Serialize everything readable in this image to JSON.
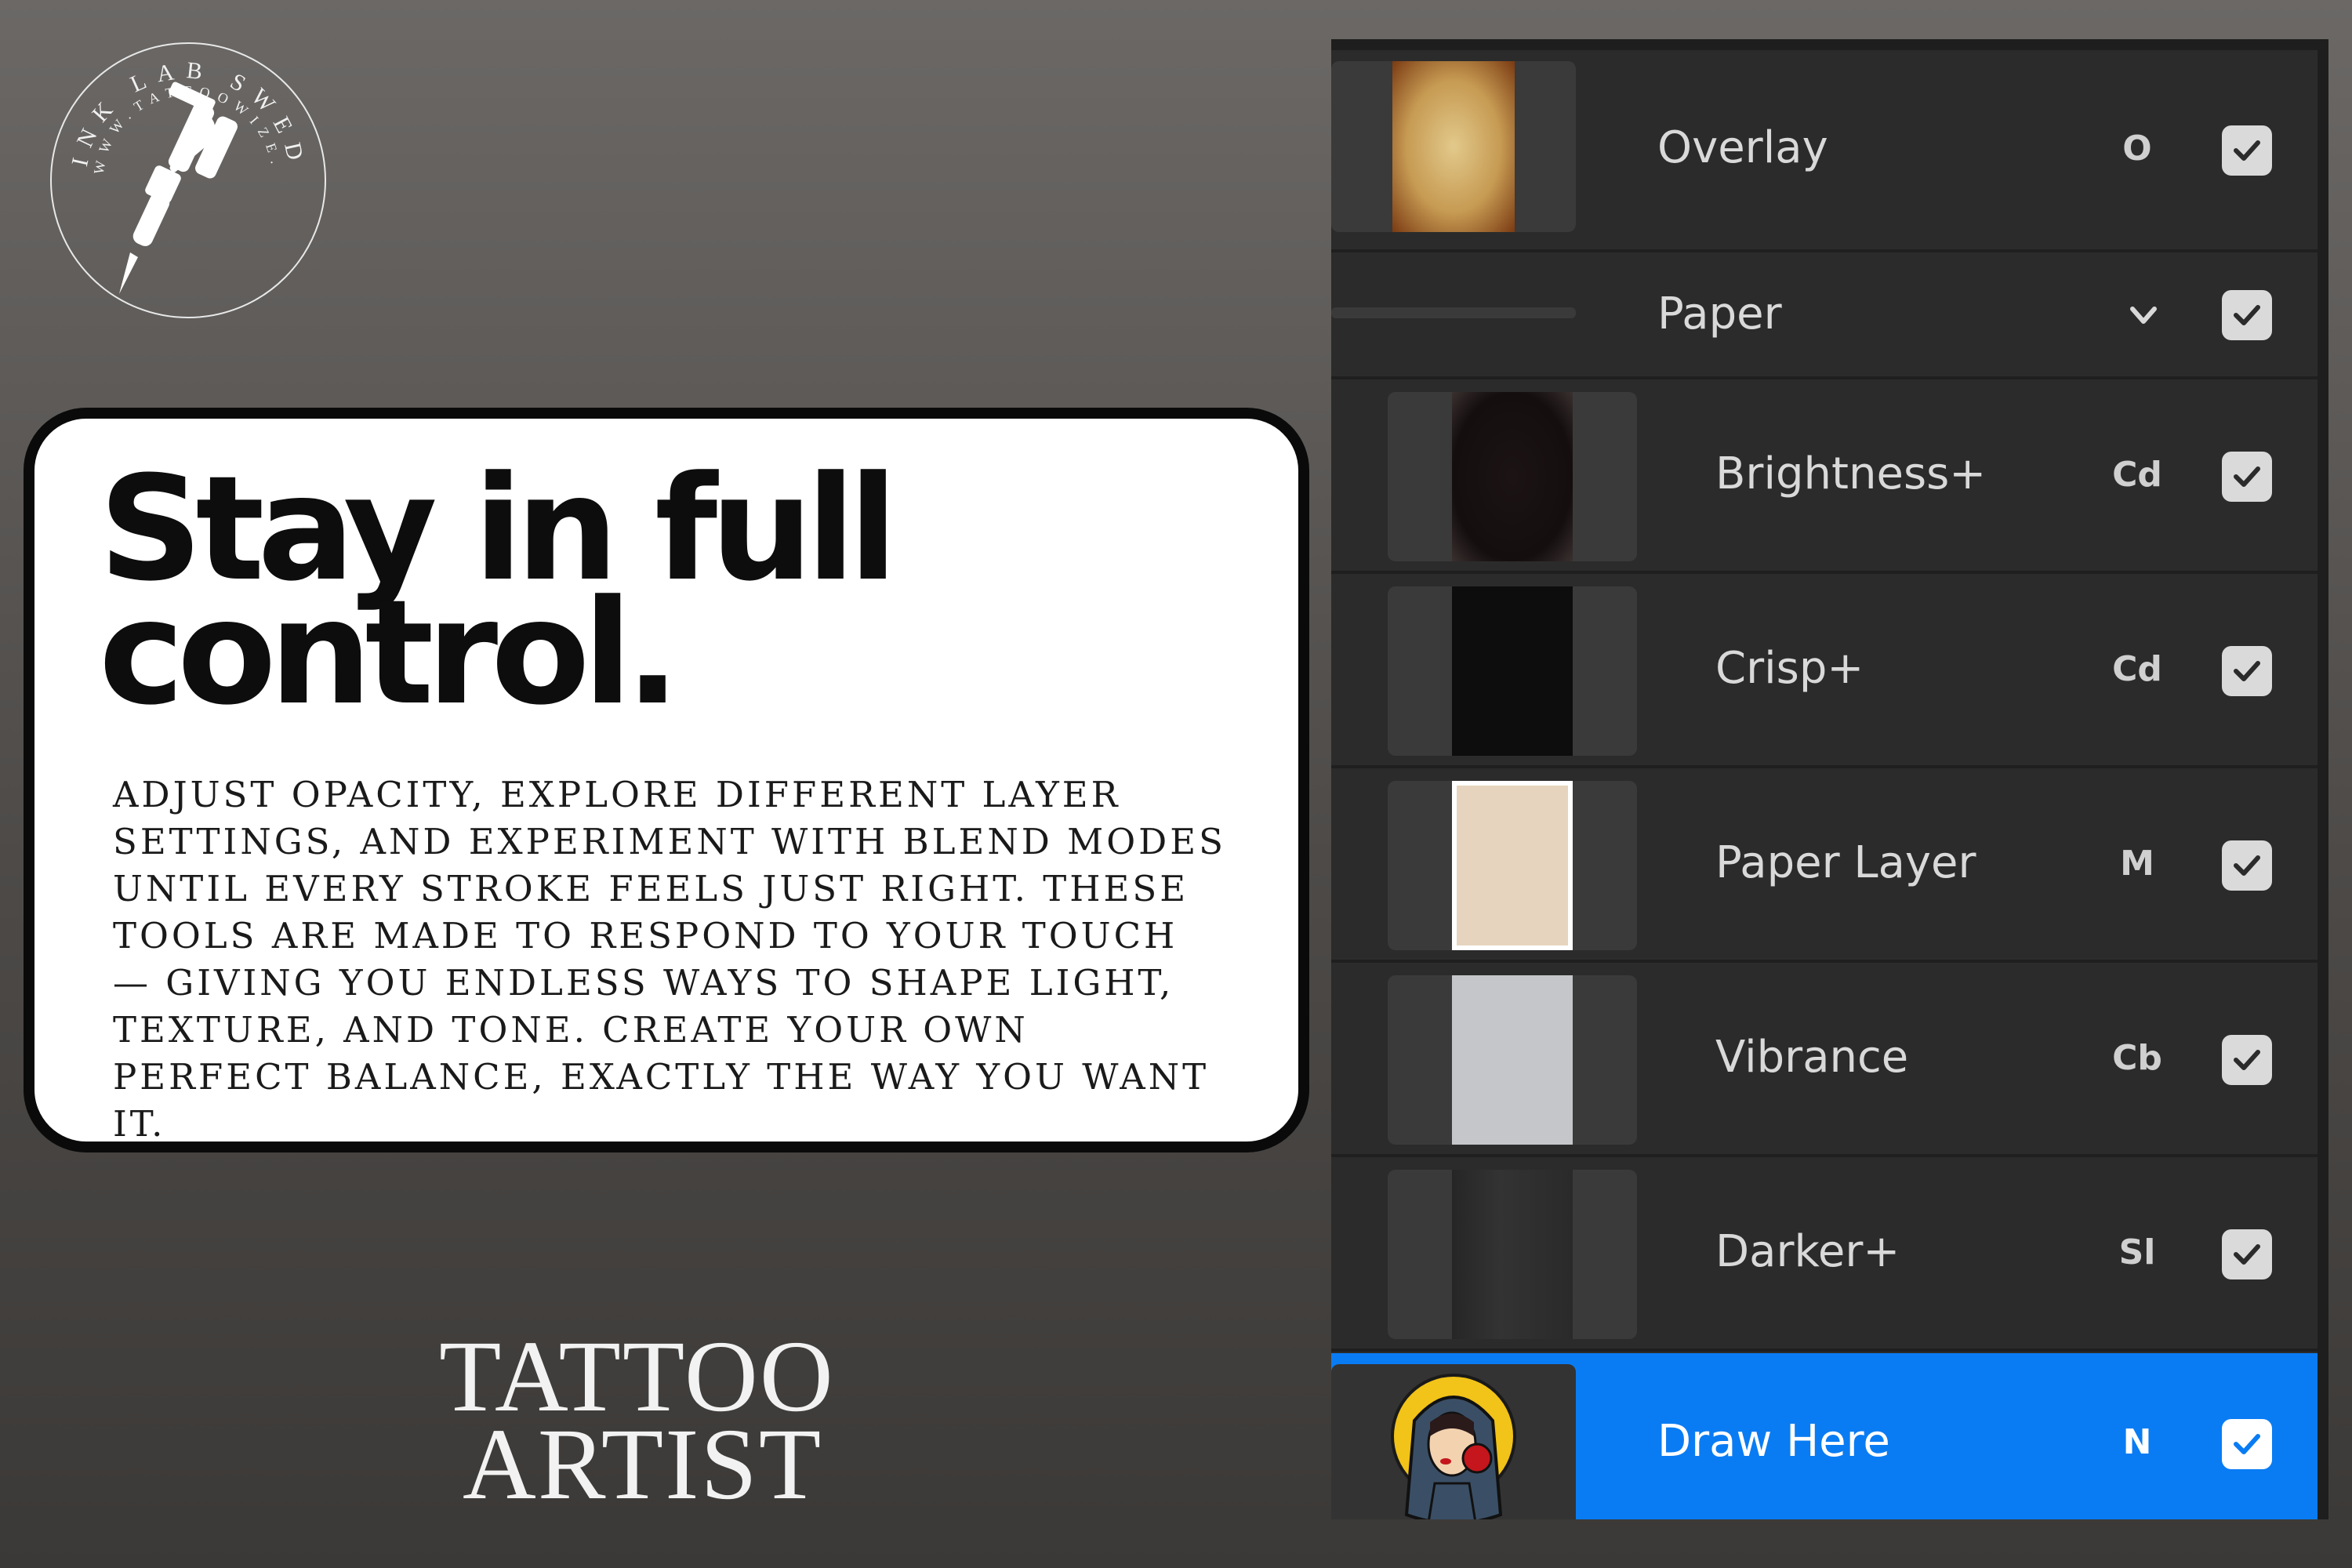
{
  "logo": {
    "ring_text_outer": "INK LAB SWEDEN",
    "ring_text_inner": "WWW.TATTOOWIZE.COM",
    "icon": "tattoo-machine-icon"
  },
  "card": {
    "headline_line1": "Stay in full",
    "headline_line2": "control.",
    "body": "Adjust opacity, explore different layer settings, and experiment with blend modes until every stroke feels just right. These tools are made to respond to your touch — giving you endless ways to shape light, texture, and tone. Create your own perfect balance, exactly the way you want it."
  },
  "wordmark": {
    "line1": "TATTOO",
    "line2": "ARTIST"
  },
  "layers": [
    {
      "name": "Overlay",
      "mode": "O",
      "checked": true,
      "thumb": "aged-paper"
    },
    {
      "name": "Paper",
      "mode": "",
      "checked": true,
      "group": true,
      "expanded": true,
      "icon": "chevron-down-icon"
    },
    {
      "name": "Brightness+",
      "mode": "Cd",
      "checked": true,
      "thumb": "dark-texture"
    },
    {
      "name": "Crisp+",
      "mode": "Cd",
      "checked": true,
      "thumb": "black-texture"
    },
    {
      "name": "Paper Layer",
      "mode": "M",
      "checked": true,
      "thumb": "beige-paper"
    },
    {
      "name": "Vibrance",
      "mode": "Cb",
      "checked": true,
      "thumb": "grey-paper"
    },
    {
      "name": "Darker+",
      "mode": "Sl",
      "checked": true,
      "thumb": "grunge-texture"
    },
    {
      "name": "Draw Here",
      "mode": "N",
      "checked": true,
      "selected": true,
      "thumb": "tattoo-lady-illustration"
    }
  ],
  "colors": {
    "selected_row": "#0a7cf3",
    "panel_bg": "#2b2b2b"
  }
}
